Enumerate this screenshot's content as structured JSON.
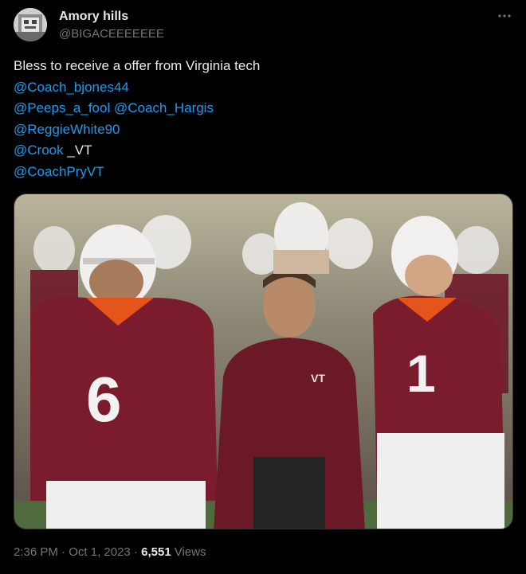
{
  "author": {
    "display_name": "Amory hills",
    "handle": "@BIGACEEEEEEE"
  },
  "tweet": {
    "text": "Bless to receive a offer from Virginia tech",
    "mentions": {
      "line1": "@Coach_bjones44",
      "line2a": "@Peeps_a_fool",
      "line2b": "@Coach_Hargis",
      "line3": "@ReggieWhite90",
      "line4": "@Crook",
      "line4_suffix": "_VT",
      "line5": "@CoachPryVT"
    }
  },
  "media": {
    "jersey_numbers": [
      "6",
      "1"
    ],
    "logo_text": "VT"
  },
  "meta": {
    "time": "2:36 PM",
    "separator": "·",
    "date": "Oct 1, 2023",
    "views_count": "6,551",
    "views_label": "Views"
  },
  "icons": {
    "more": "more-horizontal-icon"
  },
  "colors": {
    "background": "#000000",
    "text": "#e7e9ea",
    "secondary": "#71767b",
    "link": "#1d9bf0",
    "maroon": "#7a1c2e",
    "orange": "#e5541b"
  }
}
